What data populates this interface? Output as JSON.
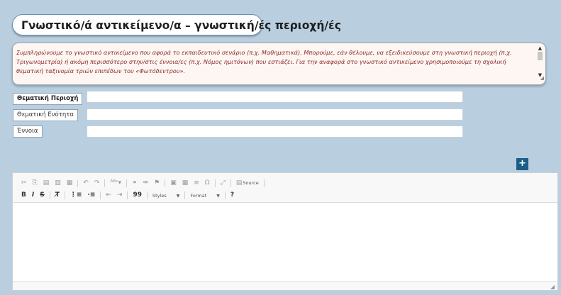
{
  "section": {
    "title": "Γνωστικό/ά αντικείμενο/α – γνωστική/ές περιοχή/ές"
  },
  "description": {
    "text": "Συμπληρώνουμε το γνωστικό αντικείμενο που αφορά το εκπαιδευτικό σενάριο (π.χ. Μαθηματικά). Μπορούμε, εάν θέλουμε, να εξειδικεύσουμε στη γνωστική περιοχή (π.χ. Τριγωνομετρία) ή ακόμη περισσότερο στην/στις έννοια/ες (π.χ. Νόμος ημιτόνων) που εστιάζει. Για την αναφορά στο γνωστικό αντικείμενο χρησιμοποιούμε τη σχολική θεματική ταξινομία τριών επιπέδων του «Φωτόδεντρου»."
  },
  "fields": {
    "area_label": "Θεματική Περιοχή",
    "area_value": "",
    "unit_label": "Θεματική Ενότητα",
    "unit_value": "",
    "concept_label": "Έννοια",
    "concept_value": ""
  },
  "add_button": {
    "label": "+"
  },
  "editor": {
    "source_label": "Source",
    "styles_label": "Styles",
    "format_label": "Format",
    "help_label": "?",
    "bold_label": "B",
    "italic_label": "I",
    "strike_label": "S",
    "quote_label": "99",
    "content": ""
  }
}
